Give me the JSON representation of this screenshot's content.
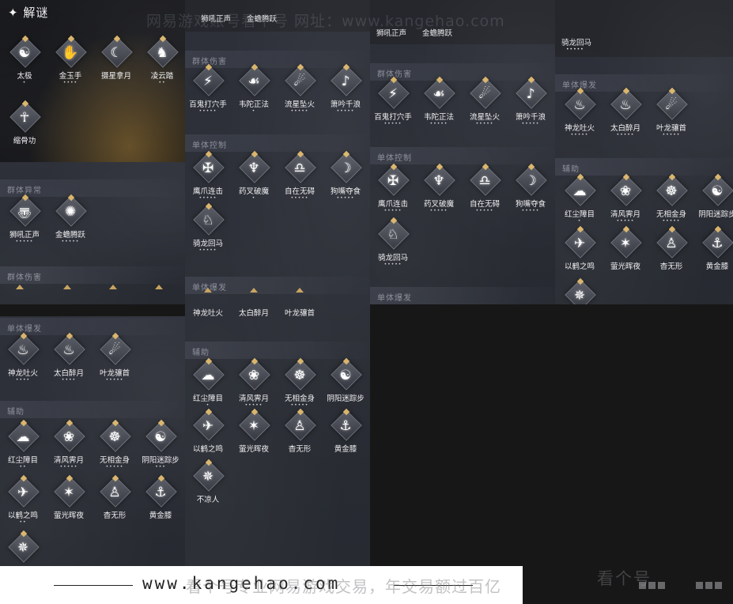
{
  "header": {
    "title": "✦ 解谜"
  },
  "watermark": {
    "text": "网易游戏账号看个号  网址：www.kangehao.com"
  },
  "banner": {
    "url": "www.kangehao.com",
    "tagline": "看个号专业网易游戏交易，年交易额过百亿",
    "logo": "看个号"
  },
  "col1": {
    "puzzle": [
      {
        "name": "太极",
        "dots": "•",
        "glyph": "☯"
      },
      {
        "name": "金玉手",
        "dots": "••••",
        "glyph": "✋"
      },
      {
        "name": "摄星拿月",
        "dots": "",
        "glyph": "☾"
      },
      {
        "name": "凌云踏",
        "dots": "••",
        "glyph": "♞"
      },
      {
        "name": "缩骨功",
        "dots": "",
        "glyph": "☥"
      }
    ],
    "sections": {
      "group_abnormal": "群体异常",
      "group_damage": "群体伤害",
      "single_burst": "单体爆发",
      "assist": "辅助"
    },
    "abnormal": [
      {
        "name": "狮吼正声",
        "dots": "•••••",
        "glyph": "〠"
      },
      {
        "name": "金蟾腾跃",
        "dots": "•••••",
        "glyph": "✺"
      }
    ],
    "burst": [
      {
        "name": "神龙吐火",
        "dots": "••••",
        "glyph": "♨"
      },
      {
        "name": "太白醉月",
        "dots": "••••",
        "glyph": "♨"
      },
      {
        "name": "叶龙骧首",
        "dots": "•••••",
        "glyph": "☄"
      }
    ],
    "assist": [
      {
        "name": "红尘障目",
        "dots": "••",
        "glyph": "☁"
      },
      {
        "name": "清风霁月",
        "dots": "•••••",
        "glyph": "❀"
      },
      {
        "name": "无相金身",
        "dots": "•••••",
        "glyph": "☸"
      },
      {
        "name": "阴阳迷踪步",
        "dots": "•••",
        "glyph": "☯"
      },
      {
        "name": "以鹤之鸣",
        "dots": "••",
        "glyph": "✈"
      },
      {
        "name": "萤光晖夜",
        "dots": "",
        "glyph": "✶"
      },
      {
        "name": "杳无形",
        "dots": "",
        "glyph": "♙"
      },
      {
        "name": "黄金膝",
        "dots": "",
        "glyph": "⚓"
      },
      {
        "name": "",
        "dots": "",
        "glyph": "✵"
      }
    ]
  },
  "col2": {
    "top_names": [
      "狮吼正声",
      "金蟾腾跃"
    ],
    "sections": {
      "group_damage": "群体伤害",
      "single_control": "单体控制",
      "single_burst": "单体爆发",
      "assist": "辅助"
    },
    "damage": [
      {
        "name": "百鬼打穴手",
        "dots": "•••••",
        "glyph": "⚡"
      },
      {
        "name": "韦陀正法",
        "dots": "•",
        "glyph": "☙"
      },
      {
        "name": "流星坠火",
        "dots": "•••••",
        "glyph": "☄"
      },
      {
        "name": "箫吟千浪",
        "dots": "•••••",
        "glyph": "♪"
      }
    ],
    "control": [
      {
        "name": "鹰爪连击",
        "dots": "•••••",
        "glyph": "✠"
      },
      {
        "name": "药叉破魔",
        "dots": "•",
        "glyph": "♆"
      },
      {
        "name": "自在无碍",
        "dots": "•••••",
        "glyph": "♎"
      },
      {
        "name": "狗嘴夺食",
        "dots": "•••••",
        "glyph": "☽"
      },
      {
        "name": "骑龙回马",
        "dots": "•••••",
        "glyph": "♘"
      }
    ],
    "burst": [
      {
        "name": "神龙吐火",
        "dots": "",
        "glyph": "♨"
      },
      {
        "name": "太白醉月",
        "dots": "",
        "glyph": "♨"
      },
      {
        "name": "叶龙骧首",
        "dots": "",
        "glyph": "☄"
      }
    ],
    "assist": [
      {
        "name": "红尘障目",
        "dots": "•",
        "glyph": "☁"
      },
      {
        "name": "清风霁月",
        "dots": "•••••",
        "glyph": "❀"
      },
      {
        "name": "无相金身",
        "dots": "•••••",
        "glyph": "☸"
      },
      {
        "name": "阴阳迷踪步",
        "dots": "",
        "glyph": "☯"
      },
      {
        "name": "以鹤之鸣",
        "dots": "",
        "glyph": "✈"
      },
      {
        "name": "萤光晖夜",
        "dots": "",
        "glyph": "✶"
      },
      {
        "name": "杳无形",
        "dots": "",
        "glyph": "♙"
      },
      {
        "name": "黄金膝",
        "dots": "",
        "glyph": "⚓"
      },
      {
        "name": "不凉人",
        "dots": "",
        "glyph": "✵"
      }
    ]
  },
  "col3": {
    "top_names": [
      "狮吼正声",
      "金蟾腾跃"
    ],
    "sections": {
      "group_damage": "群体伤害",
      "single_control": "单体控制",
      "single_burst": "单体爆发"
    },
    "damage": [
      {
        "name": "百鬼打穴手",
        "dots": "•••••",
        "glyph": "⚡"
      },
      {
        "name": "韦陀正法",
        "dots": "•••••",
        "glyph": "☙"
      },
      {
        "name": "流星坠火",
        "dots": "•••••",
        "glyph": "☄"
      },
      {
        "name": "箫吟千浪",
        "dots": "•••••",
        "glyph": "♪"
      }
    ],
    "control": [
      {
        "name": "鹰爪连击",
        "dots": "•••••",
        "glyph": "✠"
      },
      {
        "name": "药叉破魔",
        "dots": "•••••",
        "glyph": "♆"
      },
      {
        "name": "自在无碍",
        "dots": "•••••",
        "glyph": "♎"
      },
      {
        "name": "狗嘴夺食",
        "dots": "•••••",
        "glyph": "☽"
      },
      {
        "name": "骑龙回马",
        "dots": "•••••",
        "glyph": "♘"
      }
    ]
  },
  "col4": {
    "top_name": "骑龙回马",
    "top_dots": "•••••",
    "sections": {
      "single_burst": "单体爆发",
      "assist": "辅助"
    },
    "burst": [
      {
        "name": "神龙吐火",
        "dots": "•••••",
        "glyph": "♨"
      },
      {
        "name": "太白醉月",
        "dots": "•••••",
        "glyph": "♨"
      },
      {
        "name": "叶龙骧首",
        "dots": "•••••",
        "glyph": "☄"
      }
    ],
    "assist": [
      {
        "name": "红尘障目",
        "dots": "•",
        "glyph": "☁"
      },
      {
        "name": "清风霁月",
        "dots": "•••••",
        "glyph": "❀"
      },
      {
        "name": "无相金身",
        "dots": "•••••",
        "glyph": "☸"
      },
      {
        "name": "阴阳迷踪步",
        "dots": "",
        "glyph": "☯"
      },
      {
        "name": "以鹤之鸣",
        "dots": "",
        "glyph": "✈"
      },
      {
        "name": "萤光晖夜",
        "dots": "",
        "glyph": "✶"
      },
      {
        "name": "杳无形",
        "dots": "",
        "glyph": "♙"
      },
      {
        "name": "黄金膝",
        "dots": "",
        "glyph": "⚓"
      },
      {
        "name": "",
        "dots": "",
        "glyph": "✵"
      }
    ]
  }
}
